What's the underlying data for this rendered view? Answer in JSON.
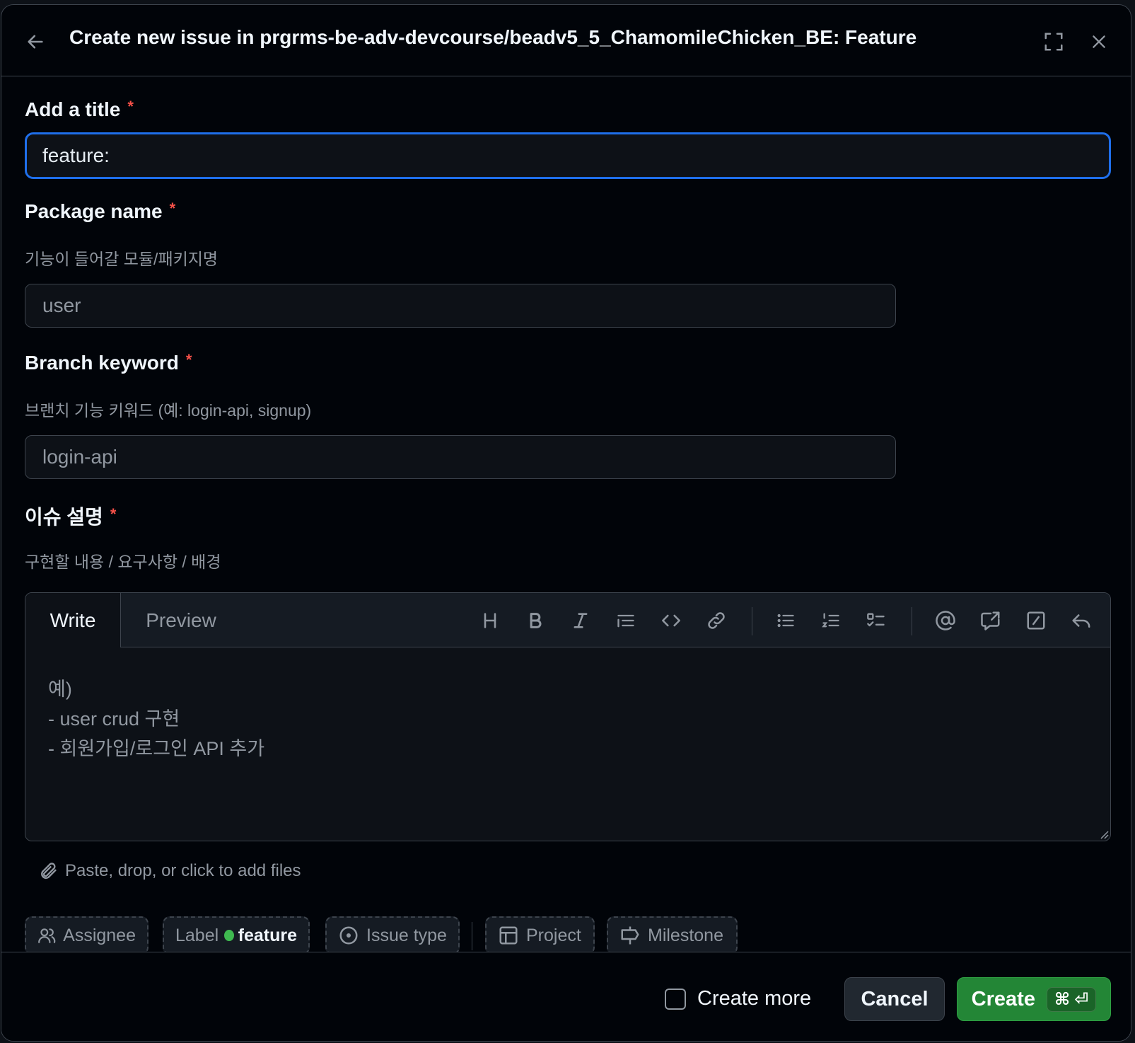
{
  "header": {
    "title": "Create new issue in prgrms-be-adv-devcourse/beadv5_5_ChamomileChicken_BE: Feature"
  },
  "fields": {
    "title": {
      "label": "Add a title",
      "required_mark": "*",
      "value": "feature: "
    },
    "package": {
      "label": "Package name",
      "required_mark": "*",
      "hint": "기능이 들어갈 모듈/패키지명",
      "placeholder": "user"
    },
    "branch": {
      "label": "Branch keyword",
      "required_mark": "*",
      "hint": "브랜치 기능 키워드 (예: login-api, signup)",
      "placeholder": "login-api"
    },
    "description": {
      "label": "이슈 설명",
      "required_mark": "*",
      "hint": "구현할 내용 / 요구사항 / 배경"
    }
  },
  "editor": {
    "tabs": {
      "write": "Write",
      "preview": "Preview"
    },
    "placeholder": "예)\n- user crud 구현\n- 회원가입/로그인 API 추가",
    "attach_text": "Paste, drop, or click to add files"
  },
  "meta": {
    "assignee": "Assignee",
    "label": "Label",
    "label_value": "feature",
    "label_color": "#3fb950",
    "issue_type": "Issue type",
    "project": "Project",
    "milestone": "Milestone"
  },
  "footer": {
    "create_more": "Create more",
    "cancel": "Cancel",
    "create": "Create",
    "shortcut_cmd": "⌘",
    "shortcut_enter": "⏎"
  },
  "colors": {
    "accent": "#1f6feb",
    "primary_button": "#238636",
    "required": "#f85149"
  }
}
